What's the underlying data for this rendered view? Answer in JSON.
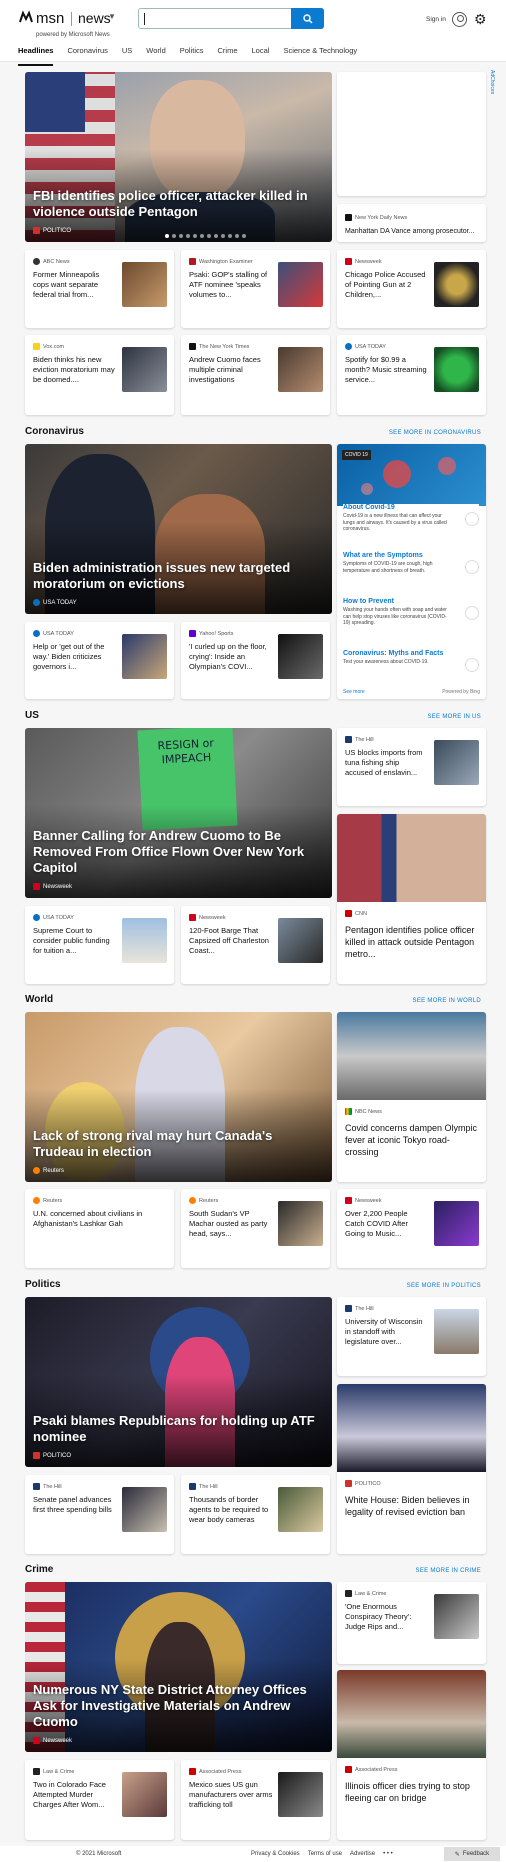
{
  "header": {
    "brand": "msn",
    "section": "news",
    "powered_by": "powered by Microsoft News",
    "search_value": "",
    "signin_label": "Sign in"
  },
  "nav": {
    "items": [
      "Headlines",
      "Coronavirus",
      "US",
      "World",
      "Politics",
      "Crime",
      "Local",
      "Science & Technology"
    ]
  },
  "ad_label": "AdChoices",
  "headlines": {
    "hero": {
      "title": "FBI identifies police officer, attacker killed in violence outside Pentagon",
      "source": "POLITICO"
    },
    "side": {
      "source": "New York Daily News",
      "title": "Manhattan DA Vance among prosecutor..."
    },
    "row1": [
      {
        "source": "ABC News",
        "title": "Former Minneapolis cops want separate federal trial from..."
      },
      {
        "source": "Washington Examiner",
        "title": "Psaki: GOP's stalling of ATF nominee 'speaks volumes to..."
      },
      {
        "source": "Newsweek",
        "title": "Chicago Police Accused of Pointing Gun at 2 Children,..."
      }
    ],
    "row2": [
      {
        "source": "Vox.com",
        "title": "Biden thinks his new eviction moratorium may be doomed...."
      },
      {
        "source": "The New York Times",
        "title": "Andrew Cuomo faces multiple criminal investigations"
      },
      {
        "source": "USA TODAY",
        "title": "Spotify for $0.99 a month? Music streaming service..."
      }
    ]
  },
  "coronavirus": {
    "section_title": "Coronavirus",
    "see_more": "SEE MORE IN CORONAVIRUS",
    "hero": {
      "title": "Biden administration issues new targeted moratorium on evictions",
      "source": "USA TODAY"
    },
    "row": [
      {
        "source": "USA TODAY",
        "title": "Help or 'get out of the way.' Biden criticizes governors i..."
      },
      {
        "source": "Yahoo! Sports",
        "title": "'I curled up on the floor, crying': Inside an Olympian's COVI..."
      }
    ],
    "widget": {
      "tag": "COVID 19",
      "items": [
        {
          "heading": "About Covid-19",
          "desc": "Covid-19 is a new illness that can affect your lungs and airways. It's caused by a virus called coronavirus."
        },
        {
          "heading": "What are the Symptoms",
          "desc": "Symptoms of COVID-19 are cough, high temperature and shortness of breath."
        },
        {
          "heading": "How to Prevent",
          "desc": "Washing your hands often with soap and water can help stop viruses like coronavirus (COVID-19) spreading."
        },
        {
          "heading": "Coronavirus: Myths and Facts",
          "desc": "Test your awareness about COVID-19."
        }
      ],
      "see_more": "See more",
      "powered": "Powered by Bing"
    }
  },
  "us": {
    "section_title": "US",
    "see_more": "SEE MORE IN US",
    "hero": {
      "title": "Banner Calling for Andrew Cuomo to Be Removed From Office Flown Over New York Capitol",
      "source": "Newsweek",
      "sign_text": "RESIGN or IMPEACH"
    },
    "side_small": {
      "source": "The Hill",
      "title": "US blocks imports from tuna fishing ship accused of enslavin..."
    },
    "side": {
      "source": "CNN",
      "title": "Pentagon identifies police officer killed in attack outside Pentagon metro..."
    },
    "row": [
      {
        "source": "USA TODAY",
        "title": "Supreme Court to consider public funding for tuition a..."
      },
      {
        "source": "Newsweek",
        "title": "120-Foot Barge That Capsized off Charleston Coast..."
      }
    ]
  },
  "world": {
    "section_title": "World",
    "see_more": "SEE MORE IN WORLD",
    "hero": {
      "title": "Lack of strong rival may hurt Canada's Trudeau in election",
      "source": "Reuters"
    },
    "side": {
      "source": "NBC News",
      "title": "Covid concerns dampen Olympic fever at iconic Tokyo road-crossing"
    },
    "row": [
      {
        "source": "Reuters",
        "title": "U.N. concerned about civilians in Afghanistan's Lashkar Gah"
      },
      {
        "source": "Reuters",
        "title": "South Sudan's VP Machar ousted as party head, says..."
      },
      {
        "source": "Newsweek",
        "title": "Over 2,200 People Catch COVID After Going to Music..."
      }
    ]
  },
  "politics": {
    "section_title": "Politics",
    "see_more": "SEE MORE IN POLITICS",
    "hero": {
      "title": "Psaki blames Republicans for holding up ATF nominee",
      "source": "POLITICO"
    },
    "side_small": {
      "source": "The Hill",
      "title": "University of Wisconsin in standoff with legislature over..."
    },
    "side": {
      "source": "POLITICO",
      "title": "White House: Biden believes in legality of revised eviction ban"
    },
    "row": [
      {
        "source": "The Hill",
        "title": "Senate panel advances first three spending bills"
      },
      {
        "source": "The Hill",
        "title": "Thousands of border agents to be required to wear body cameras"
      }
    ]
  },
  "crime": {
    "section_title": "Crime",
    "see_more": "SEE MORE IN CRIME",
    "hero": {
      "title": "Numerous NY State District Attorney Offices Ask for Investigative Materials on Andrew Cuomo",
      "source": "Newsweek"
    },
    "side_small": {
      "source": "Law & Crime",
      "title": "'One Enormous Conspiracy Theory': Judge Rips and..."
    },
    "side": {
      "source": "Associated Press",
      "title": "Illinois officer dies trying to stop fleeing car on bridge"
    },
    "row": [
      {
        "source": "Law & Crime",
        "title": "Two in Colorado Face Attempted Murder Charges After Wom..."
      },
      {
        "source": "Associated Press",
        "title": "Mexico sues US gun manufacturers over arms trafficking toll"
      }
    ]
  },
  "footer": {
    "copyright": "© 2021 Microsoft",
    "links": [
      "Privacy & Cookies",
      "Terms of use",
      "Advertise",
      "• • •"
    ],
    "feedback": "Feedback"
  }
}
